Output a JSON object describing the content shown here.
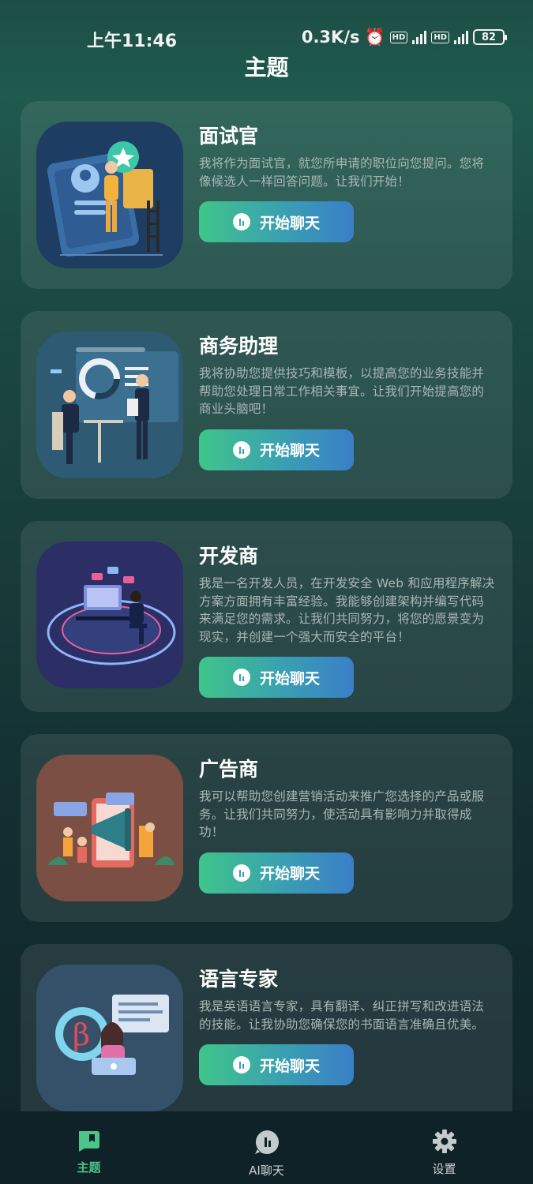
{
  "status": {
    "time": "上午11:46",
    "speed": "0.3K/s",
    "battery": "82"
  },
  "header": {
    "title": "主题"
  },
  "cards": [
    {
      "title": "面试官",
      "desc": "我将作为面试官，就您所申请的职位向您提问。您将像候选人一样回答问题。让我们开始！",
      "button": "开始聊天"
    },
    {
      "title": "商务助理",
      "desc": "我将协助您提供技巧和模板，以提高您的业务技能并帮助您处理日常工作相关事宜。让我们开始提高您的商业头脑吧！",
      "button": "开始聊天"
    },
    {
      "title": "开发商",
      "desc": "我是一名开发人员，在开发安全 Web 和应用程序解决方案方面拥有丰富经验。我能够创建架构并编写代码来满足您的需求。让我们共同努力，将您的愿景变为现实，并创建一个强大而安全的平台！",
      "button": "开始聊天"
    },
    {
      "title": "广告商",
      "desc": "我可以帮助您创建营销活动来推广您选择的产品或服务。让我们共同努力，使活动具有影响力并取得成功！",
      "button": "开始聊天"
    },
    {
      "title": "语言专家",
      "desc": "我是英语语言专家，具有翻译、纠正拼写和改进语法的技能。让我协助您确保您的书面语言准确且优美。",
      "button": "开始聊天"
    }
  ],
  "tabs": [
    {
      "label": "主题",
      "icon": "book-icon"
    },
    {
      "label": "AI聊天",
      "icon": "chat-icon"
    },
    {
      "label": "设置",
      "icon": "gear-icon"
    }
  ],
  "colors": {
    "accent": "#4cc48a",
    "button_start": "#3fc58a",
    "button_end": "#3a7fc8"
  }
}
